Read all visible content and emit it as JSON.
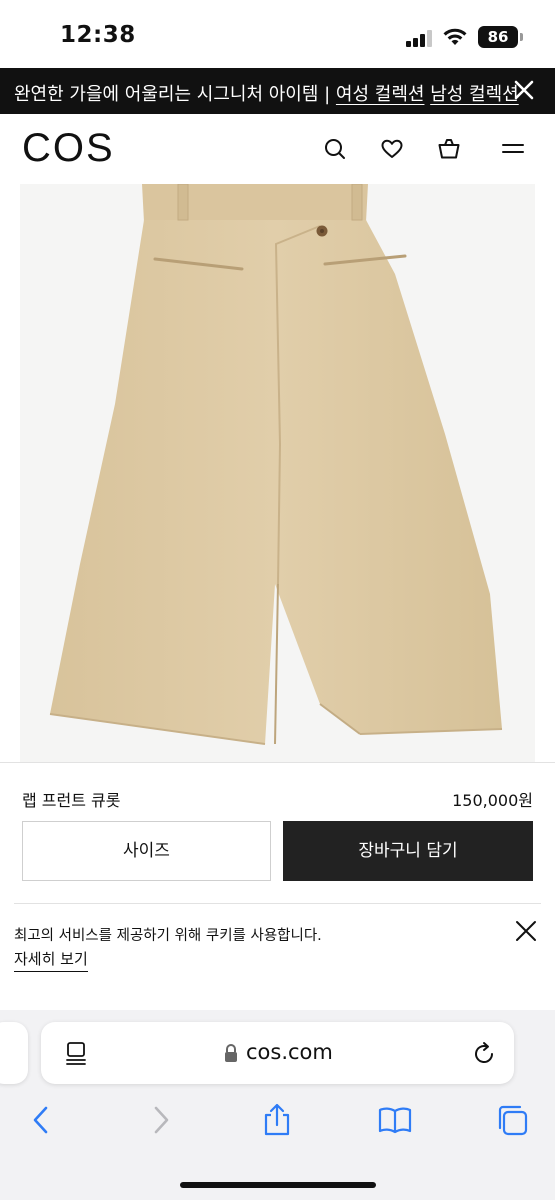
{
  "status_bar": {
    "time": "12:38",
    "battery": "86",
    "icons": [
      "cellular-signal-icon",
      "wifi-icon",
      "battery-icon"
    ]
  },
  "promo": {
    "text": "완연한 가을에 어울리는 시그니처 아이템 | ",
    "link_women": "여성 컬렉션",
    "link_men": "남성 컬렉션",
    "close_icon": "close-icon"
  },
  "header": {
    "logo": "COS",
    "icons": [
      "search-icon",
      "heart-icon",
      "shopping-bag-icon",
      "menu-icon"
    ]
  },
  "product": {
    "name": "랩 프런트 큐롯",
    "price": "150,000원",
    "size_button": "사이즈",
    "add_to_cart_button": "장바구니 담기",
    "image_color": "#dbc6a0"
  },
  "cookie": {
    "text": "최고의 서비스를 제공하기 위해 쿠키를 사용합니다.",
    "link": "자세히 보기"
  },
  "safari": {
    "url": "cos.com",
    "toolbar_icons": [
      "back-icon",
      "forward-icon",
      "share-icon",
      "bookmarks-icon",
      "tabs-icon"
    ]
  }
}
